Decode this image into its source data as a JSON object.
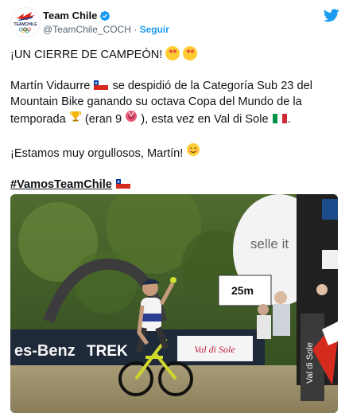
{
  "account": {
    "display_name": "Team Chile",
    "handle": "@TeamChile_COCH",
    "separator": " · ",
    "follow_label": "Seguir",
    "logo_text": "TEAMCHILE"
  },
  "tweet": {
    "line1": "¡UN CIERRE DE CAMPEÓN!",
    "p2_a": "Martín Vidaurre",
    "p2_b": "se despidió de la Categoría Sub 23 del Mountain Bike ganando su octava Copa del Mundo de la temporada",
    "p2_c": "(eran 9",
    "p2_d": "), esta vez en Val di Sole",
    "p2_e": ".",
    "line3": "¡Estamos muy orgullosos, Martín!",
    "hashtag": "#VamosTeamChile"
  },
  "photo": {
    "sign_text": "25m",
    "banner_left": "es-Benz",
    "banner_mid": "TREK",
    "banner_right": "Val di Sole",
    "inflatable_text": "selle it",
    "right_pole_text": "Val di Sole"
  },
  "colors": {
    "accent": "#1d9bf0",
    "verified": "#1d9bf0",
    "chile_red": "#d52b1e",
    "chile_blue": "#0039a6",
    "italy_green": "#009246",
    "italy_red": "#ce2b37"
  },
  "icons": {
    "verified": "verified-badge-icon",
    "bird": "twitter-bird-icon",
    "chile_flag": "chile-flag-icon",
    "italy_flag": "italy-flag-icon",
    "trophy": "trophy-icon",
    "medal": "medal-icon",
    "star_eyes": "star-struck-emoji",
    "smile": "smiling-face-emoji"
  }
}
